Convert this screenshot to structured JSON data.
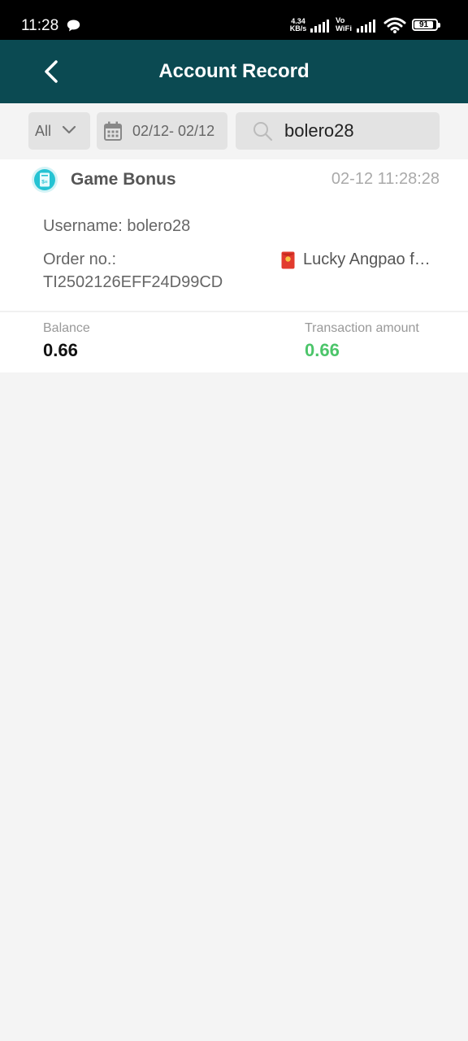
{
  "status_bar": {
    "time": "11:28",
    "net_speed_value": "4.34",
    "net_speed_unit": "KB/s",
    "vowifi_top": "Vo",
    "vowifi_bottom": "WiFi",
    "battery": "91",
    "icons": [
      "chat-icon",
      "signal-icon",
      "wifi-icon",
      "battery-icon"
    ]
  },
  "header": {
    "title": "Account Record",
    "background": "#0b4a52",
    "back_icon": "chevron-left-icon"
  },
  "filters": {
    "type_selected": "All",
    "date_range": "02/12- 02/12",
    "search_value": "bolero28",
    "icons": [
      "chevron-down-icon",
      "calendar-icon",
      "search-icon"
    ]
  },
  "records": [
    {
      "type": "Game Bonus",
      "time": "02-12 11:28:28",
      "username_line": "Username: bolero28",
      "order_label": "Order no.:",
      "order_no": "TI2502126EFF24D99CD",
      "remark": "Lucky Angpao f…",
      "balance_label": "Balance",
      "balance": "0.66",
      "amount_label": "Transaction amount",
      "amount": "0.66",
      "amount_color": "#4cc56a",
      "icons": [
        "bonus-receipt-icon",
        "red-envelope-icon"
      ]
    }
  ]
}
